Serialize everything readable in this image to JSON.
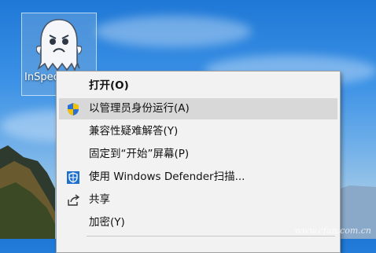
{
  "desktop": {
    "icon_label": "InSpectre.exe"
  },
  "context_menu": {
    "items": [
      {
        "label": "打开(O)",
        "bold": true
      },
      {
        "label": "以管理员身份运行(A)",
        "icon": "uac-shield-icon"
      },
      {
        "label": "兼容性疑难解答(Y)"
      },
      {
        "label": "固定到“开始”屏幕(P)"
      },
      {
        "label": "使用 Windows Defender扫描...",
        "icon": "windows-defender-icon"
      },
      {
        "label": "共享",
        "icon": "share-icon"
      },
      {
        "label": "加密(Y)"
      }
    ]
  },
  "watermark": "www.cfan.com.cn",
  "colors": {
    "menu_bg": "#f2f2f2",
    "menu_highlight": "#d8d8d8",
    "defender_blue": "#1f6fd1",
    "uac_blue": "#2a6fd6",
    "uac_yellow": "#f2c200"
  }
}
